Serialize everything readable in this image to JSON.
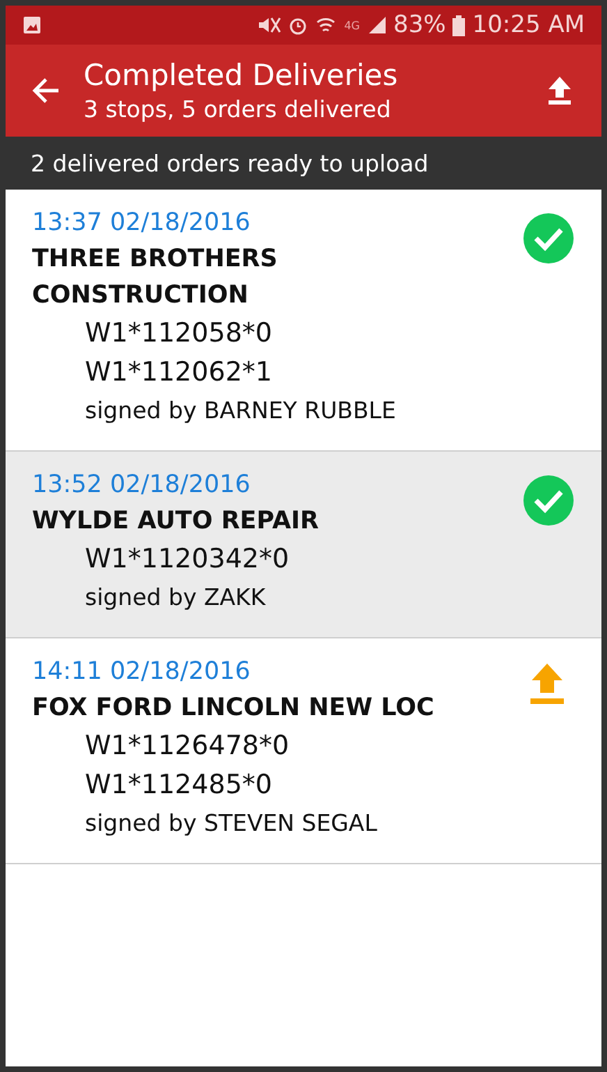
{
  "status_bar": {
    "network_type": "4G",
    "battery": "83%",
    "time": "10:25 AM"
  },
  "app_bar": {
    "title": "Completed Deliveries",
    "subtitle": "3 stops, 5 orders delivered"
  },
  "notice": "2 delivered orders ready to upload",
  "deliveries": [
    {
      "timestamp": "13:37 02/18/2016",
      "customer": "THREE BROTHERS CONSTRUCTION",
      "orders": [
        "W1*112058*0",
        "W1*112062*1"
      ],
      "signature": "signed by BARNEY RUBBLE",
      "kind": "uploaded",
      "selected": false
    },
    {
      "timestamp": "13:52 02/18/2016",
      "customer": "WYLDE AUTO REPAIR",
      "orders": [
        "W1*1120342*0"
      ],
      "signature": "signed by ZAKK",
      "kind": "uploaded",
      "selected": true
    },
    {
      "timestamp": "14:11 02/18/2016",
      "customer": "FOX FORD LINCOLN NEW LOC",
      "orders": [
        "W1*1126478*0",
        "W1*112485*0"
      ],
      "signature": "signed by STEVEN SEGAL",
      "kind": "pending",
      "selected": false
    }
  ]
}
